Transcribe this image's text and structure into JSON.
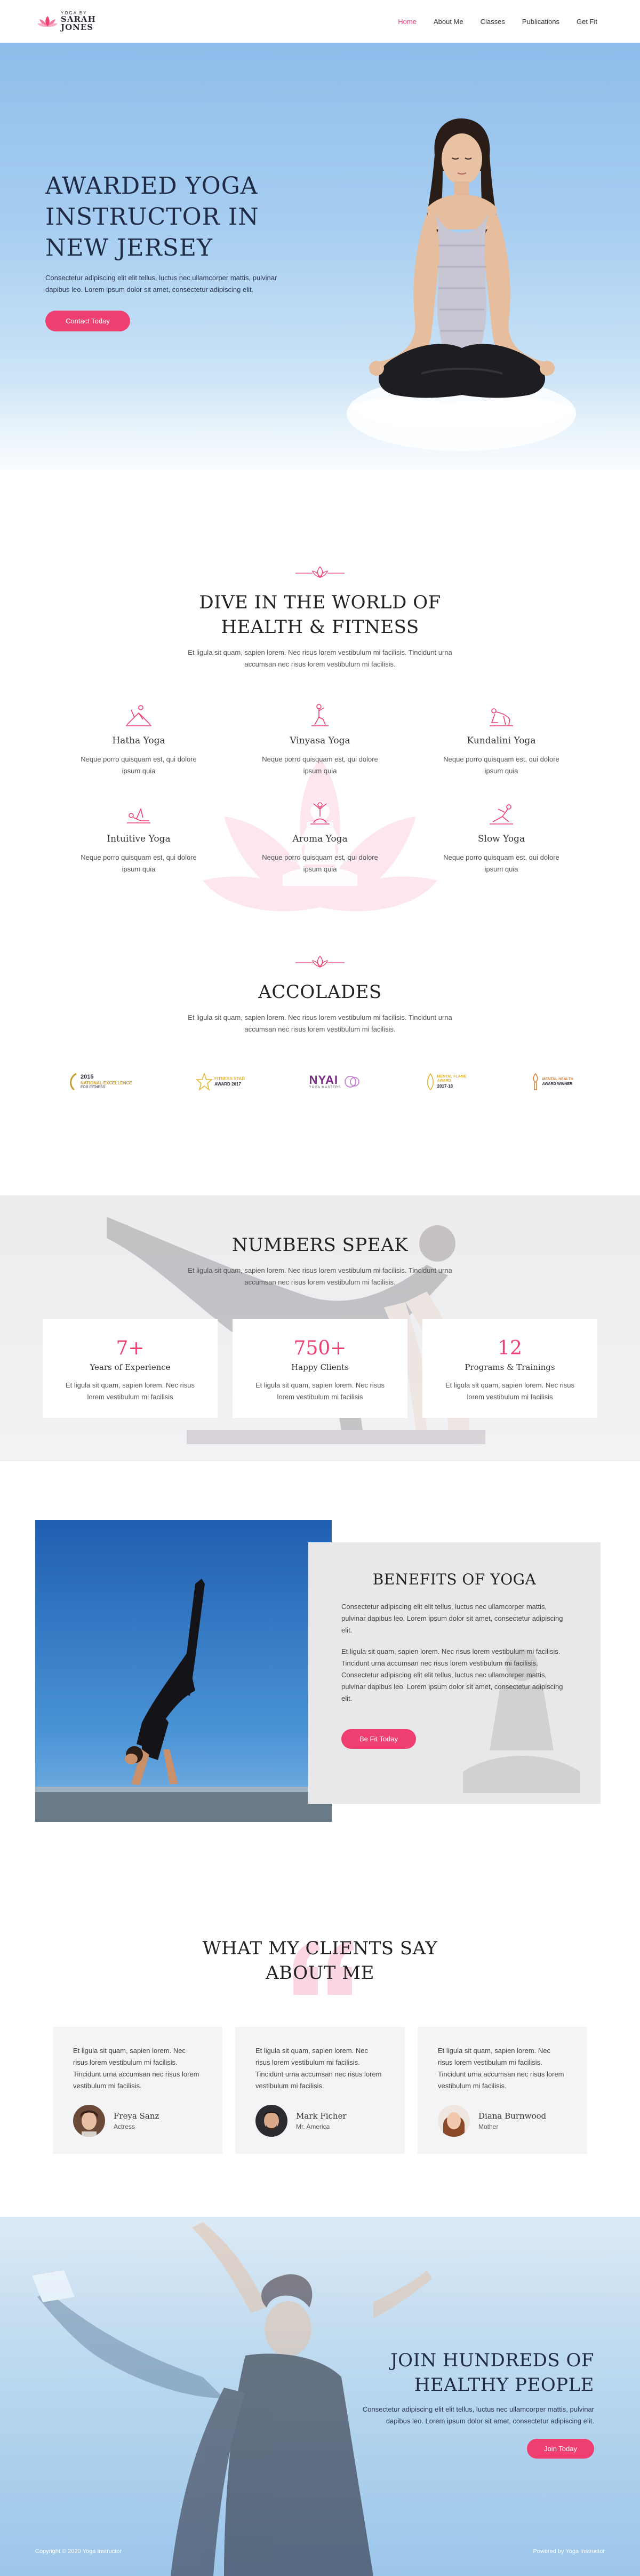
{
  "header": {
    "logo_small": "YOGA BY",
    "logo_name_line1": "SARAH",
    "logo_name_line2": "JONES",
    "nav": [
      "Home",
      "About Me",
      "Classes",
      "Publications",
      "Get Fit"
    ]
  },
  "hero": {
    "title": "AWARDED YOGA INSTRUCTOR IN NEW JERSEY",
    "description": "Consectetur adipiscing elit elit tellus, luctus nec ullamcorper mattis, pulvinar dapibus leo. Lorem ipsum dolor sit amet, consectetur adipiscing elit.",
    "button": "Contact Today"
  },
  "dive": {
    "title_line1": "DIVE IN THE WORLD OF",
    "title_line2": "HEALTH & FITNESS",
    "description": "Et ligula sit quam, sapien lorem. Nec risus lorem vestibulum mi facilisis. Tincidunt urna accumsan nec risus lorem vestibulum mi facilisis.",
    "services": [
      {
        "name": "Hatha Yoga",
        "desc": "Neque porro quisquam est, qui dolore ipsum quia",
        "icon": "hatha-pose-icon"
      },
      {
        "name": "Vinyasa Yoga",
        "desc": "Neque porro quisquam est, qui dolore ipsum quia",
        "icon": "vinyasa-pose-icon"
      },
      {
        "name": "Kundalini Yoga",
        "desc": "Neque porro quisquam est, qui dolore ipsum quia",
        "icon": "kundalini-pose-icon"
      },
      {
        "name": "Intuitive Yoga",
        "desc": "Neque porro quisquam est, qui dolore ipsum quia",
        "icon": "intuitive-pose-icon"
      },
      {
        "name": "Aroma Yoga",
        "desc": "Neque porro quisquam est, qui dolore ipsum quia",
        "icon": "aroma-pose-icon"
      },
      {
        "name": "Slow Yoga",
        "desc": "Neque porro quisquam est, qui dolore ipsum quia",
        "icon": "slow-pose-icon"
      }
    ]
  },
  "accolades": {
    "title": "ACCOLADES",
    "description": "Et ligula sit quam, sapien lorem. Nec risus lorem vestibulum mi facilisis. Tincidunt urna accumsan nec risus lorem vestibulum mi facilisis.",
    "awards": [
      {
        "line1": "2015",
        "line2": "NATIONAL EXCELLENCE",
        "line3": "FOR FITNESS"
      },
      {
        "line1": "FITNESS STAR",
        "line2": "AWARD 2017",
        "line3": ""
      },
      {
        "line1": "NYAI",
        "line2": "YOGA MASTERS",
        "line3": ""
      },
      {
        "line1": "MENTAL FLAME",
        "line2": "AWARD",
        "line3": "2017-18"
      },
      {
        "line1": "MENTAL HEALTH",
        "line2": "AWARD WINNER",
        "line3": ""
      }
    ]
  },
  "numbers": {
    "title": "NUMBERS SPEAK",
    "description": "Et ligula sit quam, sapien lorem. Nec risus lorem vestibulum mi facilisis. Tincidunt urna accumsan nec risus lorem vestibulum mi facilisis.",
    "stats": [
      {
        "value": "7+",
        "label": "Years of Experience",
        "desc": "Et ligula sit quam, sapien lorem. Nec risus lorem vestibulum mi facilisis"
      },
      {
        "value": "750+",
        "label": "Happy Clients",
        "desc": "Et ligula sit quam, sapien lorem. Nec risus lorem vestibulum mi facilisis"
      },
      {
        "value": "12",
        "label": "Programs & Trainings",
        "desc": "Et ligula sit quam, sapien lorem. Nec risus lorem vestibulum mi facilisis"
      }
    ]
  },
  "benefits": {
    "title": "BENEFITS OF YOGA",
    "p1": "Consectetur adipiscing elit elit tellus, luctus nec ullamcorper mattis, pulvinar dapibus leo. Lorem ipsum dolor sit amet, consectetur adipiscing elit.",
    "p2": "Et ligula sit quam, sapien lorem. Nec risus lorem vestibulum mi facilisis. Tincidunt urna accumsan nec risus lorem vestibulum mi facilisis. Consectetur adipiscing elit elit tellus, luctus nec ullamcorper mattis, pulvinar dapibus leo. Lorem ipsum dolor sit amet, consectetur adipiscing elit.",
    "button": "Be Fit Today"
  },
  "testimonials": {
    "title_line1": "WHAT MY CLIENTS SAY",
    "title_line2": "ABOUT ME",
    "items": [
      {
        "text": "Et ligula sit quam, sapien lorem. Nec risus lorem vestibulum mi facilisis. Tincidunt urna accumsan nec risus lorem vestibulum mi facilisis.",
        "name": "Freya Sanz",
        "role": "Actress"
      },
      {
        "text": "Et ligula sit quam, sapien lorem. Nec risus lorem vestibulum mi facilisis. Tincidunt urna accumsan nec risus lorem vestibulum mi facilisis.",
        "name": "Mark Ficher",
        "role": "Mr. America"
      },
      {
        "text": "Et ligula sit quam, sapien lorem. Nec risus lorem vestibulum mi facilisis. Tincidunt urna accumsan nec risus lorem vestibulum mi facilisis.",
        "name": "Diana Burnwood",
        "role": "Mother"
      }
    ]
  },
  "join": {
    "title_line1": "JOIN HUNDREDS OF",
    "title_line2": "HEALTHY PEOPLE",
    "description": "Consectetur adipiscing elit elit tellus, luctus nec ullamcorper mattis, pulvinar dapibus leo. Lorem ipsum dolor sit amet, consectetur adipiscing elit.",
    "button": "Join Today"
  },
  "footer": {
    "copyright": "Copyright © 2020 Yoga Instructor",
    "powered": "Powered by Yoga Instructor"
  },
  "colors": {
    "accent": "#ef3f70",
    "heading": "#1f2a44",
    "sky": "#9cc6ea"
  }
}
